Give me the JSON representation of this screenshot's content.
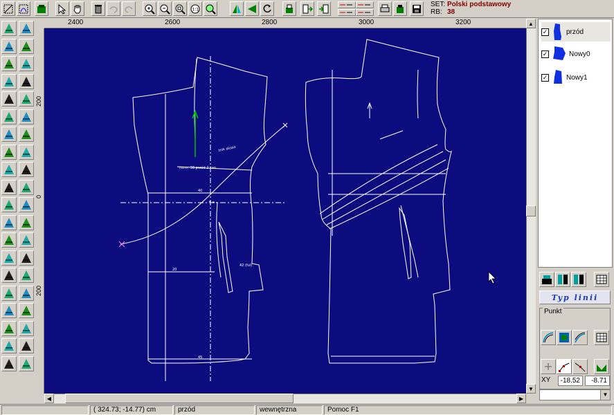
{
  "set_info": {
    "set_label": "SET:",
    "set_value": "Polski podstawowy",
    "rb_label": "RB:",
    "rb_value": "38"
  },
  "ruler": {
    "top_labels": [
      "2400",
      "2600",
      "2800",
      "3000",
      "3200"
    ],
    "left_labels": [
      "200",
      "0",
      "200"
    ]
  },
  "layers": [
    {
      "name": "przód",
      "checked": true,
      "selected": true
    },
    {
      "name": "Nowy0",
      "checked": true,
      "selected": false
    },
    {
      "name": "Nowy1",
      "checked": true,
      "selected": false
    }
  ],
  "panel": {
    "typ_linii": "Typ linii",
    "punkt_label": "Punkt",
    "xy_label": "XY",
    "xy_x": "-18.52",
    "xy_y": "-8.71"
  },
  "statusbar": {
    "coords": "( 324.73; -14.77) cm",
    "layer": "przód",
    "mode": "wewnętrzna",
    "help": "Pomoc F1"
  },
  "canvas_labels": {
    "l1": "tnik aksso",
    "l2": "rozm. 38 przód 2 kan.",
    "l3": "40",
    "l4": "20",
    "l5": "42 (ful)",
    "l6": "45"
  },
  "colors": {
    "canvas_bg": "#0c0c7e",
    "pattern_line": "#ffffff",
    "grain_arrow": "#00c000",
    "dark_red_text": "#800000"
  }
}
